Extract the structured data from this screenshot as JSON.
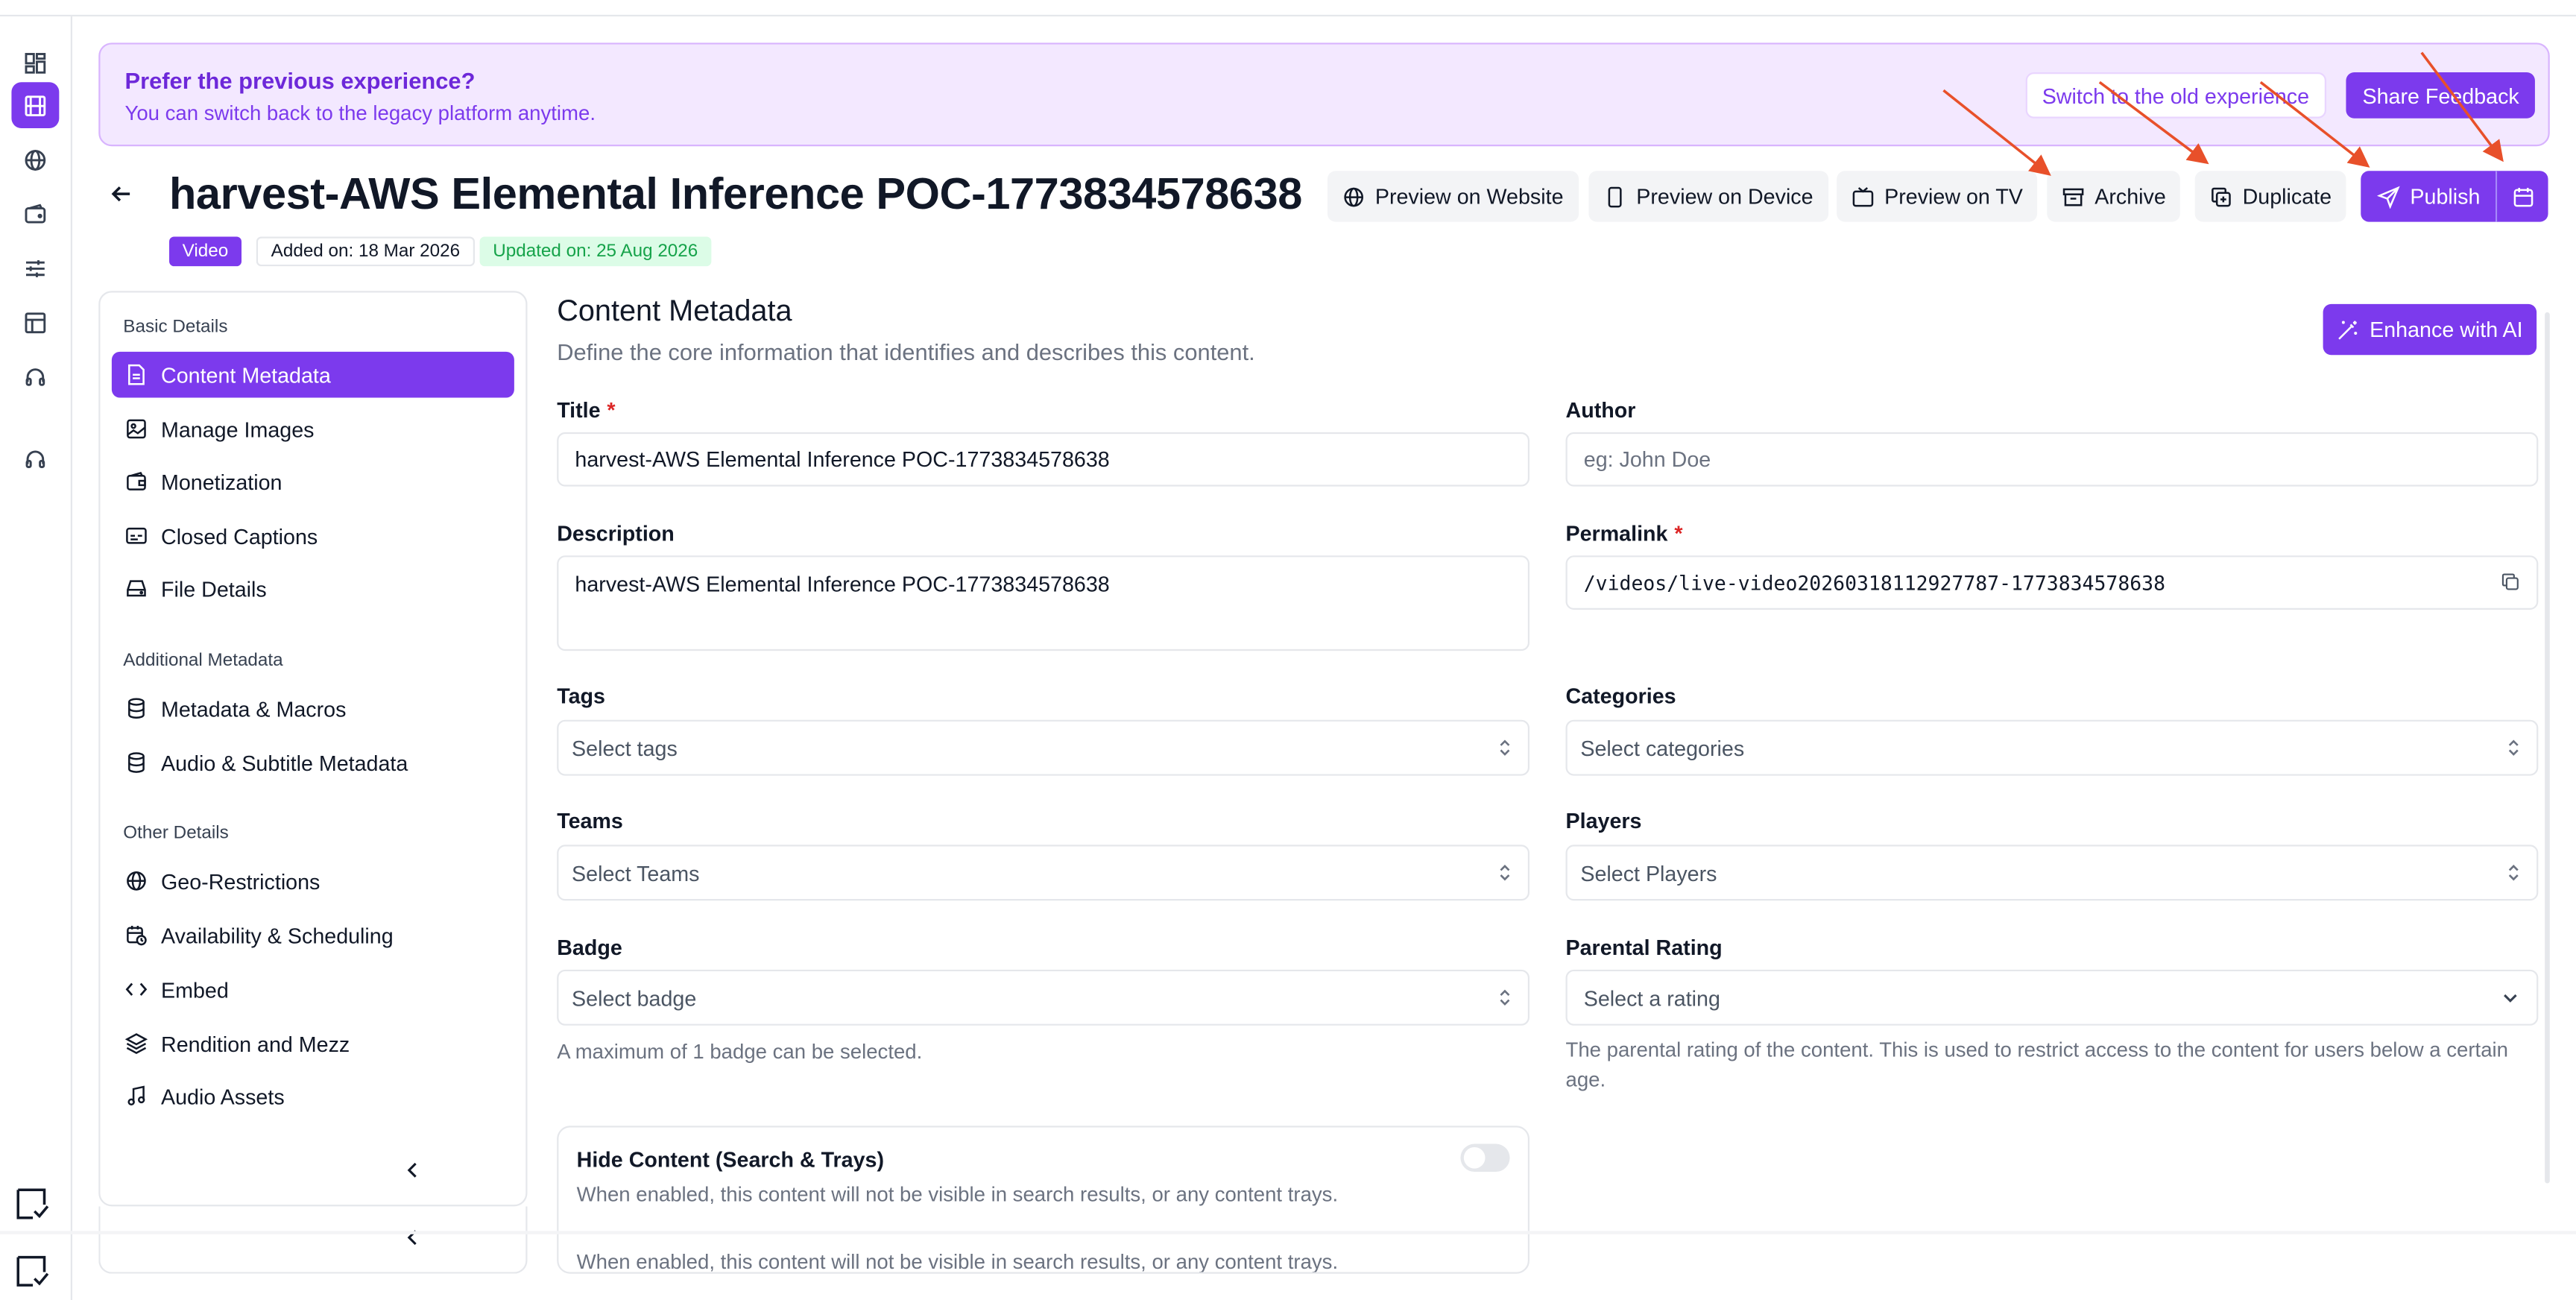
{
  "banner": {
    "title": "Prefer the previous experience?",
    "subtitle": "You can switch back to the legacy platform anytime.",
    "switch_label": "Switch to the old experience",
    "feedback_label": "Share Feedback"
  },
  "header": {
    "title": "harvest-AWS Elemental Inference POC-1773834578638",
    "type_chip": "Video",
    "added": "Added on: 18 Mar 2026",
    "updated": "Updated on: 25 Aug 2026",
    "actions": {
      "preview_website": "Preview on Website",
      "preview_device": "Preview on Device",
      "preview_tv": "Preview on TV",
      "archive": "Archive",
      "duplicate": "Duplicate",
      "publish": "Publish"
    }
  },
  "nav": {
    "basic_heading": "Basic Details",
    "basic": [
      "Content Metadata",
      "Manage Images",
      "Monetization",
      "Closed Captions",
      "File Details"
    ],
    "additional_heading": "Additional Metadata",
    "additional": [
      "Metadata & Macros",
      "Audio & Subtitle Metadata"
    ],
    "other_heading": "Other Details",
    "other": [
      "Geo-Restrictions",
      "Availability & Scheduling",
      "Embed",
      "Rendition and Mezz",
      "Audio Assets"
    ]
  },
  "main": {
    "section_title": "Content Metadata",
    "section_subtitle": "Define the core information that identifies and describes this content.",
    "enhance_label": "Enhance with AI",
    "title_label": "Title",
    "title_value": "harvest-AWS Elemental Inference POC-1773834578638",
    "author_label": "Author",
    "author_placeholder": "eg: John Doe",
    "description_label": "Description",
    "description_value": "harvest-AWS Elemental Inference POC-1773834578638",
    "permalink_label": "Permalink",
    "permalink_value": "/videos/live-video20260318112927787-1773834578638",
    "tags_label": "Tags",
    "tags_placeholder": "Select tags",
    "categories_label": "Categories",
    "categories_placeholder": "Select categories",
    "teams_label": "Teams",
    "teams_placeholder": "Select Teams",
    "players_label": "Players",
    "players_placeholder": "Select Players",
    "badge_label": "Badge",
    "badge_placeholder": "Select badge",
    "badge_help": "A maximum of 1 badge can be selected.",
    "rating_label": "Parental Rating",
    "rating_placeholder": "Select a rating",
    "rating_help": "The parental rating of the content. This is used to restrict access to the content for users below a certain age.",
    "hide_title": "Hide Content (Search & Trays)",
    "hide_desc": "When enabled, this content will not be visible in search results, or any content trays.",
    "hide_toggle": "off"
  },
  "colors": {
    "accent": "#7c3aed",
    "banner_bg": "#f3e8ff",
    "annotation_arrow": "#e8502a",
    "updated_green": "#16a34a"
  }
}
